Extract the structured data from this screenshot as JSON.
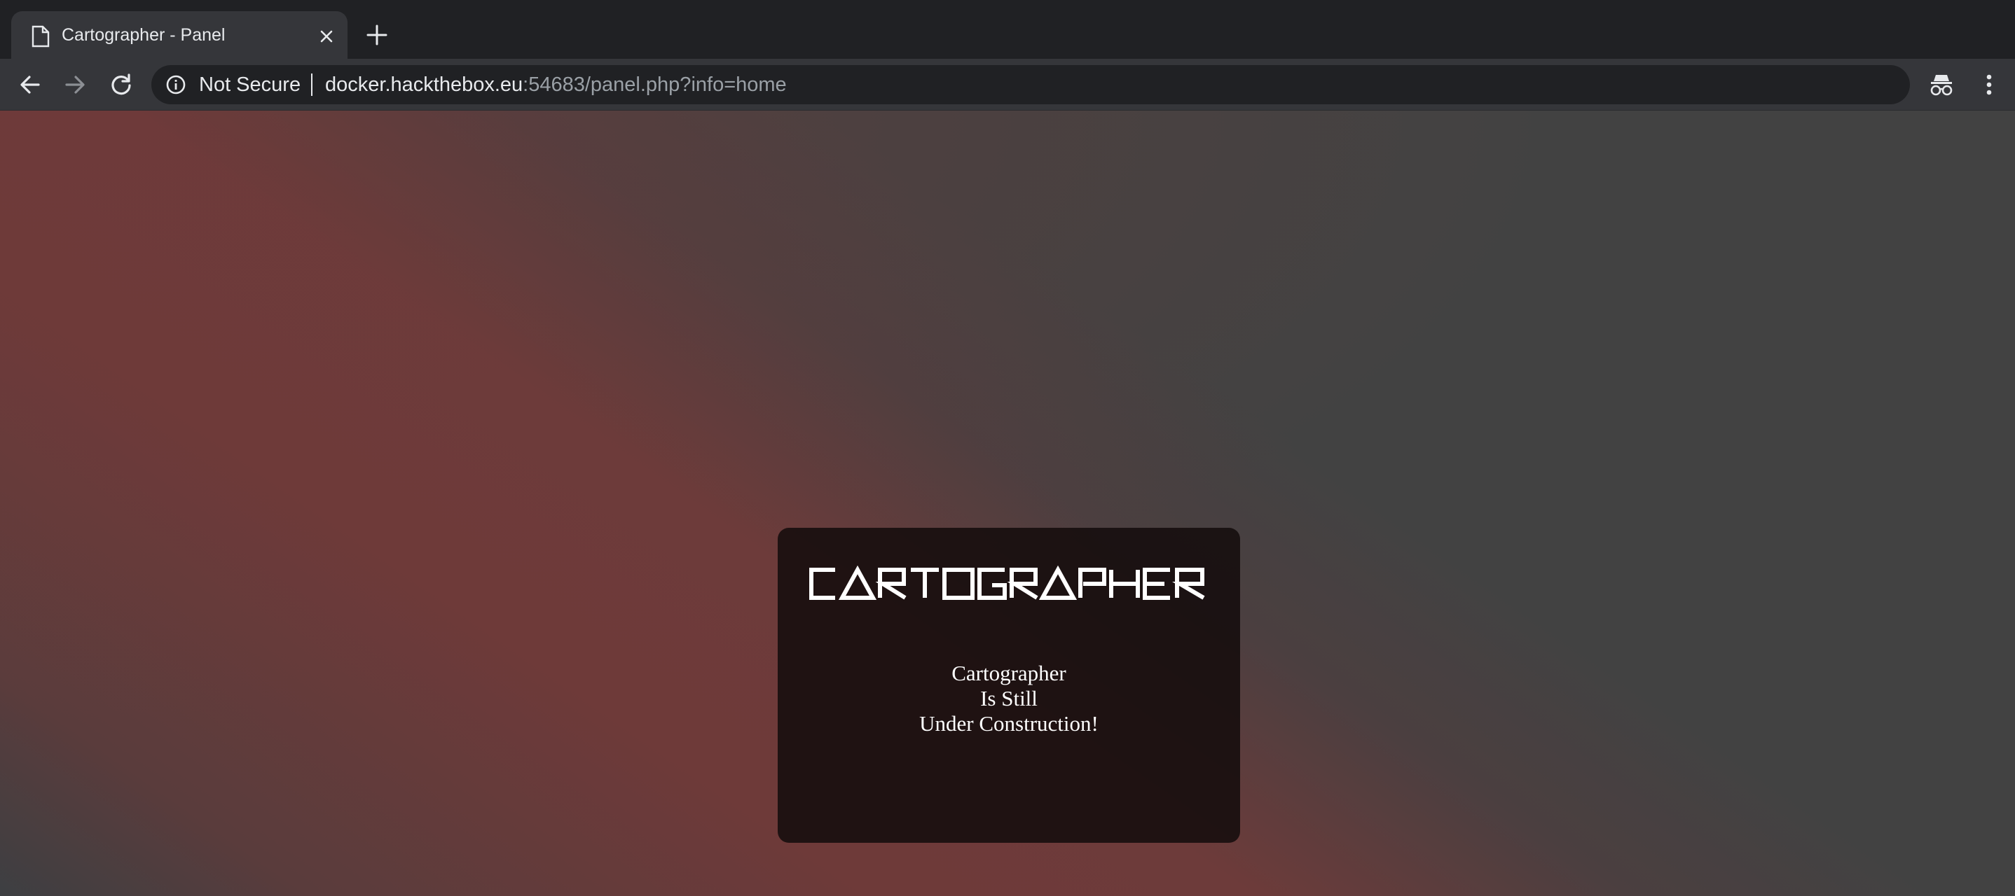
{
  "browser": {
    "tab": {
      "title": "Cartographer - Panel",
      "favicon": "document-icon"
    },
    "toolbar": {
      "security_label": "Not Secure",
      "url_host": "docker.hackthebox.eu",
      "url_rest": ":54683/panel.php?info=home"
    }
  },
  "page": {
    "logo_text": "CARTOGRAPHER",
    "message_lines": [
      "Cartographer",
      "Is Still",
      "Under Construction!"
    ]
  },
  "colors": {
    "accent_red": "#6e3a39",
    "page_gray": "#424242",
    "card_bg": "#140c0c"
  }
}
